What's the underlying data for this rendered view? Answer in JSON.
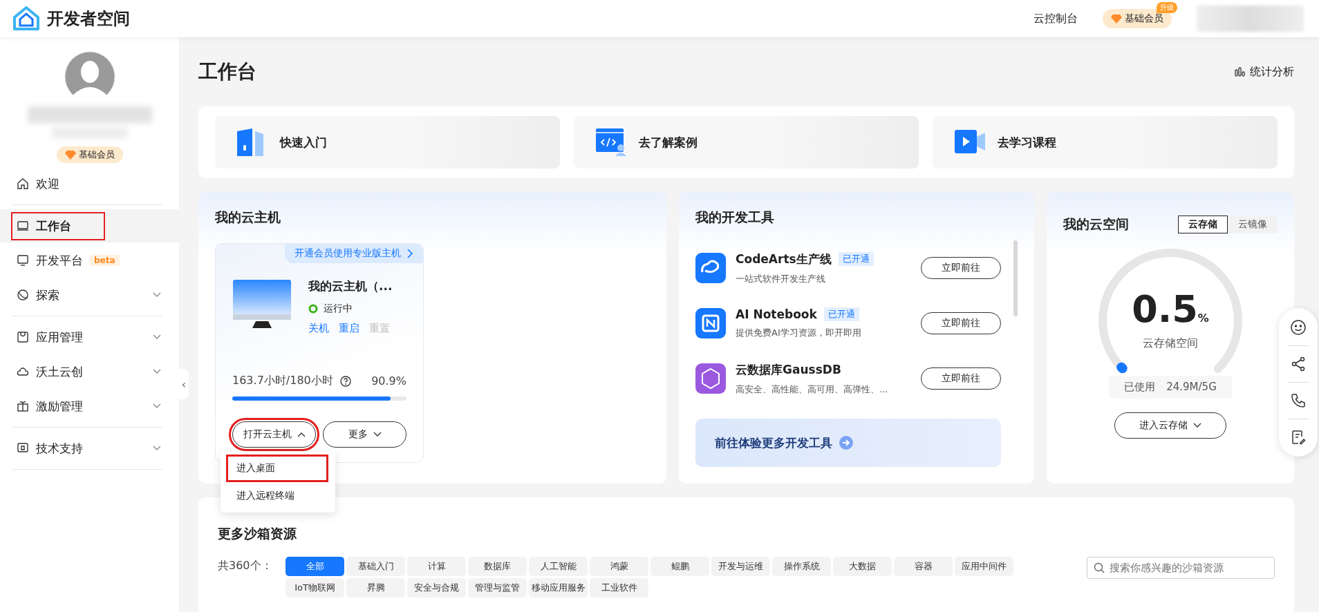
{
  "header": {
    "logo_text": "开发者空间",
    "console_link": "云控制台",
    "member_badge": "基础会员",
    "upgrade_tag": "升级"
  },
  "sidebar": {
    "member_badge": "基础会员",
    "collapse_glyph": "‹",
    "groups": [
      [
        {
          "label": "欢迎",
          "selected": false,
          "highlighted": false
        }
      ],
      [
        {
          "label": "工作台",
          "selected": true,
          "highlighted": true
        },
        {
          "label": "开发平台",
          "selected": false,
          "highlighted": false,
          "tag": "beta"
        },
        {
          "label": "探索",
          "selected": false,
          "highlighted": false,
          "expanded": false
        }
      ],
      [
        {
          "label": "应用管理",
          "selected": false,
          "highlighted": false,
          "expanded": false
        },
        {
          "label": "沃土云创",
          "selected": false,
          "highlighted": false,
          "expanded": false
        },
        {
          "label": "激励管理",
          "selected": false,
          "highlighted": false,
          "expanded": false
        }
      ],
      [
        {
          "label": "技术支持",
          "selected": false,
          "highlighted": false,
          "expanded": false
        }
      ]
    ]
  },
  "page": {
    "title": "工作台",
    "stats_link": "统计分析"
  },
  "quick_links": [
    "快速入门",
    "去了解案例",
    "去学习课程"
  ],
  "cloud_host": {
    "title": "我的云主机",
    "promo": "开通会员使用专业版主机",
    "name": "我的云主机（...",
    "status": "运行中",
    "actions": [
      {
        "label": "关机",
        "disabled": false
      },
      {
        "label": "重启",
        "disabled": false
      },
      {
        "label": "重置",
        "disabled": true
      }
    ],
    "usage": "163.7小时/180小时",
    "usage_percent": "90.9%",
    "level": 0.909,
    "buttons": [
      {
        "label": "打开云主机",
        "expanded": true,
        "highlighted": true
      },
      {
        "label": "更多",
        "expanded": false,
        "highlighted": false
      }
    ],
    "menu": [
      {
        "label": "进入桌面",
        "highlighted": true
      },
      {
        "label": "进入远程终端",
        "highlighted": false
      }
    ]
  },
  "dev_tools": {
    "title": "我的开发工具",
    "items": [
      {
        "name": "CodeArts生产线",
        "status": "已开通",
        "desc": "一站式软件开发生产线",
        "button": "立即前往",
        "color": "#1677ff"
      },
      {
        "name": "AI Notebook",
        "status": "已开通",
        "desc": "提供免费AI学习资源，即开即用",
        "button": "立即前往",
        "color": "#1677ff"
      },
      {
        "name": "云数据库GaussDB",
        "desc": "高安全、高性能、高可用、高弹性、...",
        "button": "立即前往",
        "color": "#9b59e0"
      }
    ],
    "banner": "前往体验更多开发工具"
  },
  "cloud_space": {
    "title": "我的云空间",
    "tabs": [
      {
        "label": "云存储",
        "selected": true
      },
      {
        "label": "云镜像",
        "selected": false
      }
    ],
    "value": "0.5",
    "unit": "%",
    "level": 0.005,
    "caption": "云存储空间",
    "used_label": "已使用",
    "used_value": "24.9M/5G",
    "button": "进入云存储"
  },
  "sandbox": {
    "title": "更多沙箱资源",
    "count": "共360个：",
    "search": {
      "placeholder": "搜索你感兴趣的沙箱资源"
    },
    "tags": [
      {
        "label": "全部",
        "selected": true
      },
      {
        "label": "基础入门",
        "selected": false
      },
      {
        "label": "计算",
        "selected": false
      },
      {
        "label": "数据库",
        "selected": false
      },
      {
        "label": "人工智能",
        "selected": false
      },
      {
        "label": "鸿蒙",
        "selected": false
      },
      {
        "label": "鲲鹏",
        "selected": false
      },
      {
        "label": "开发与运维",
        "selected": false
      },
      {
        "label": "操作系统",
        "selected": false
      },
      {
        "label": "大数据",
        "selected": false
      },
      {
        "label": "容器",
        "selected": false
      },
      {
        "label": "应用中间件",
        "selected": false
      },
      {
        "label": "IoT物联网",
        "selected": false
      },
      {
        "label": "昇腾",
        "selected": false
      },
      {
        "label": "安全与合规",
        "selected": false
      },
      {
        "label": "管理与监管",
        "selected": false
      },
      {
        "label": "移动应用服务",
        "selected": false
      },
      {
        "label": "工业软件",
        "selected": false
      }
    ]
  }
}
